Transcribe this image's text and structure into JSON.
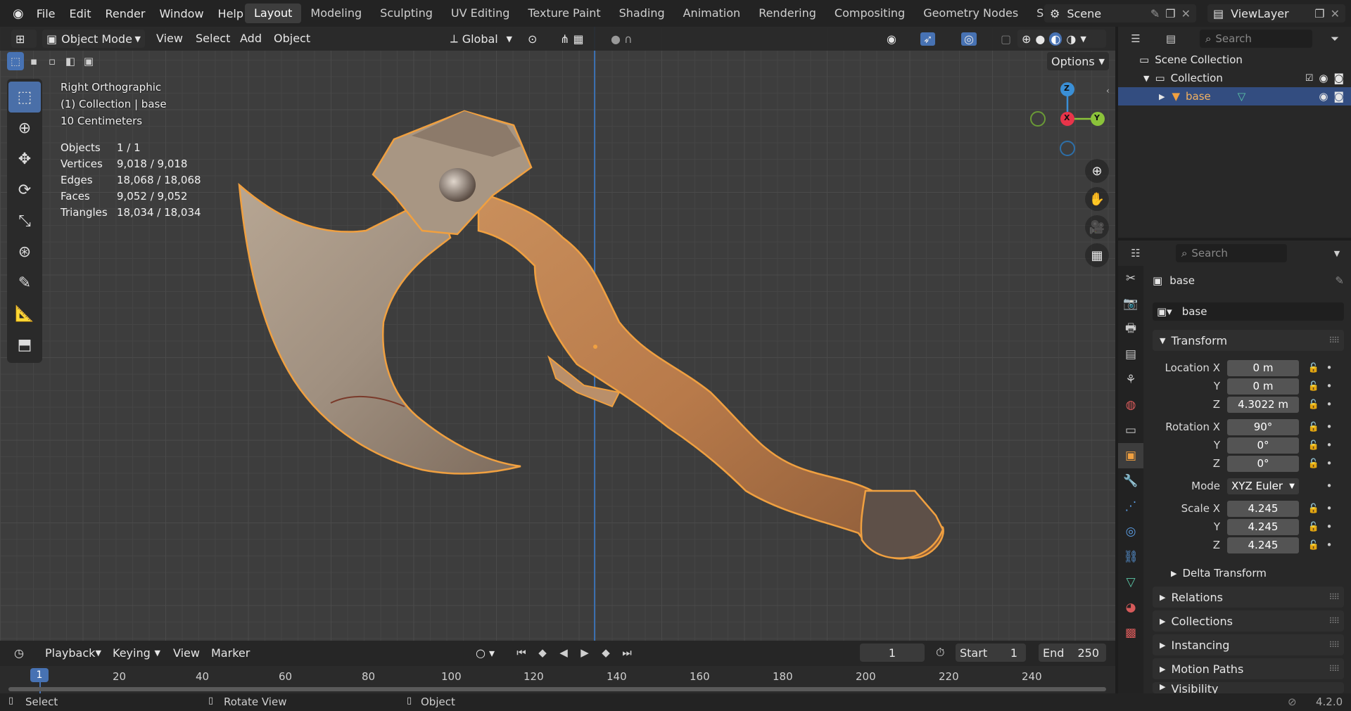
{
  "topbar": {
    "menus": [
      "File",
      "Edit",
      "Render",
      "Window",
      "Help"
    ],
    "workspaces": [
      "Layout",
      "Modeling",
      "Sculpting",
      "UV Editing",
      "Texture Paint",
      "Shading",
      "Animation",
      "Rendering",
      "Compositing",
      "Geometry Nodes",
      "Scripting"
    ],
    "active_workspace": "Layout",
    "scene": "Scene",
    "view_layer": "ViewLayer"
  },
  "viewport": {
    "mode": "Object Mode",
    "menus": [
      "View",
      "Select",
      "Add",
      "Object"
    ],
    "transform_orientation": "Global",
    "options": "Options",
    "view_name": "Right Orthographic",
    "collection_info": "(1) Collection | base",
    "scale_info": "10 Centimeters",
    "stats": [
      {
        "label": "Objects",
        "value": "1 / 1"
      },
      {
        "label": "Vertices",
        "value": "9,018 / 9,018"
      },
      {
        "label": "Edges",
        "value": "18,068 / 18,068"
      },
      {
        "label": "Faces",
        "value": "9,052 / 9,052"
      },
      {
        "label": "Triangles",
        "value": "18,034 / 18,034"
      }
    ],
    "gizmo": {
      "z": "Z",
      "x": "X",
      "y": "Y"
    },
    "colors": {
      "accent": "#4772b3",
      "select_outline": "#f0a040",
      "axis_x": "#e8344a",
      "axis_y": "#8bc33a",
      "axis_z": "#3a8fd6"
    }
  },
  "timeline": {
    "menus": [
      "Playback",
      "Keying",
      "View",
      "Marker"
    ],
    "current_frame": "1",
    "start_label": "Start",
    "start": "1",
    "end_label": "End",
    "end": "250",
    "ticks": [
      "20",
      "40",
      "60",
      "80",
      "100",
      "120",
      "140",
      "160",
      "180",
      "200",
      "220",
      "240"
    ],
    "playhead": "1"
  },
  "statusbar": {
    "items": [
      "Select",
      "Rotate View",
      "Object"
    ],
    "version": "4.2.0"
  },
  "outliner": {
    "search_placeholder": "Search",
    "scene_collection": "Scene Collection",
    "collection": "Collection",
    "object": "base"
  },
  "properties": {
    "search_placeholder": "Search",
    "object_name": "base",
    "datablock": "base",
    "transform_label": "Transform",
    "location": {
      "label_x": "Location X",
      "x": "0 m",
      "y": "0 m",
      "z": "4.3022 m"
    },
    "rotation": {
      "label_x": "Rotation X",
      "x": "90°",
      "y": "0°",
      "z": "0°"
    },
    "mode_label": "Mode",
    "mode": "XYZ Euler",
    "scale": {
      "label_x": "Scale X",
      "x": "4.245",
      "y": "4.245",
      "z": "4.245"
    },
    "axis_y": "Y",
    "axis_z": "Z",
    "sections": [
      "Delta Transform",
      "Relations",
      "Collections",
      "Instancing",
      "Motion Paths",
      "Visibility"
    ]
  }
}
